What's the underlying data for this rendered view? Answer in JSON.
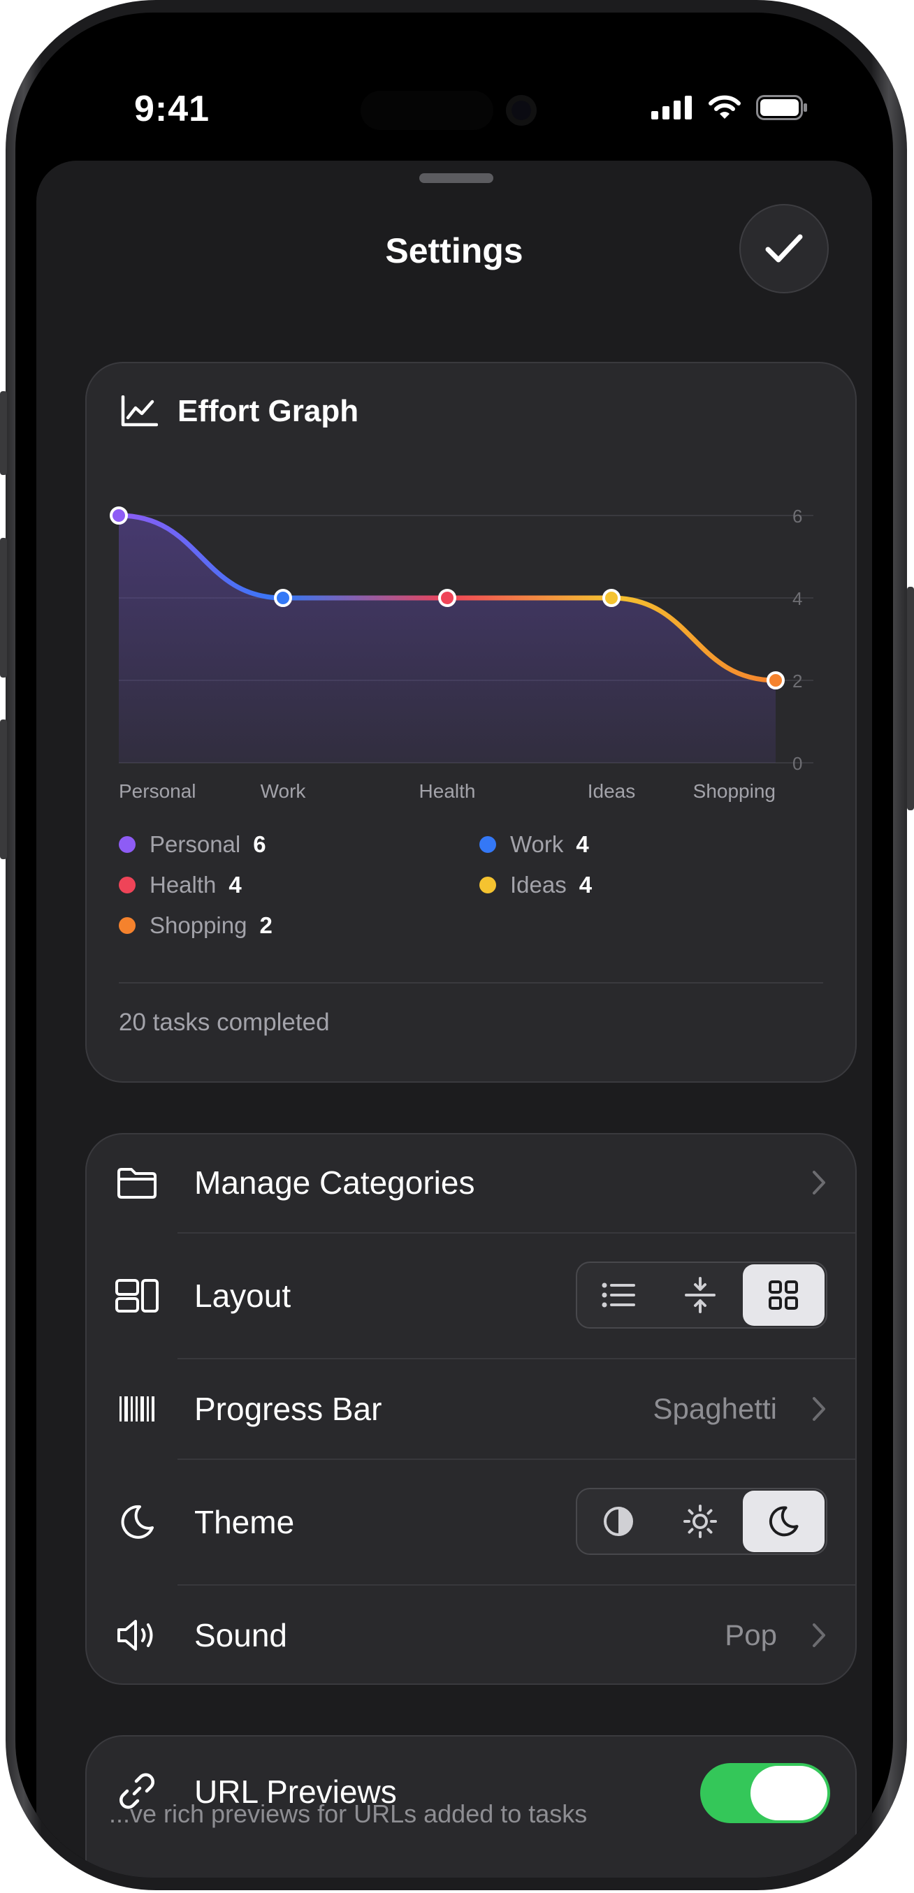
{
  "status_bar": {
    "time": "9:41"
  },
  "sheet": {
    "title": "Settings"
  },
  "effort_graph": {
    "title": "Effort Graph",
    "footer": "20 tasks completed"
  },
  "chart_data": {
    "type": "line",
    "categories": [
      "Personal",
      "Work",
      "Health",
      "Ideas",
      "Shopping"
    ],
    "values": [
      6,
      4,
      4,
      4,
      2
    ],
    "colors": [
      "#8e5cf5",
      "#3478f6",
      "#ef4458",
      "#f5c330",
      "#f5822d"
    ],
    "y_ticks": [
      "0",
      "2",
      "4",
      "6"
    ],
    "ylim": [
      0,
      6
    ],
    "grid": true,
    "fill": "area",
    "legend": [
      {
        "name": "Personal",
        "value": "6",
        "color": "#8e5cf5"
      },
      {
        "name": "Work",
        "value": "4",
        "color": "#3478f6"
      },
      {
        "name": "Health",
        "value": "4",
        "color": "#ef4458"
      },
      {
        "name": "Ideas",
        "value": "4",
        "color": "#f5c330"
      },
      {
        "name": "Shopping",
        "value": "2",
        "color": "#f5822d"
      }
    ]
  },
  "settings": {
    "manage_categories": {
      "label": "Manage Categories"
    },
    "layout": {
      "label": "Layout",
      "options": [
        "list-icon",
        "compact-icon",
        "grid-icon"
      ],
      "selected": "grid-icon"
    },
    "progress_bar": {
      "label": "Progress Bar",
      "value": "Spaghetti"
    },
    "theme": {
      "label": "Theme",
      "options": [
        "auto-contrast-icon",
        "sun-icon",
        "moon-icon"
      ],
      "selected": "moon-icon"
    },
    "sound": {
      "label": "Sound",
      "value": "Pop"
    }
  },
  "url_previews": {
    "label": "URL Previews",
    "enabled": true,
    "description": "...ve rich previews for URLs added to tasks"
  },
  "colors": {
    "accent_green": "#34c759",
    "background": "#1c1c1e",
    "card": "#29292c"
  }
}
